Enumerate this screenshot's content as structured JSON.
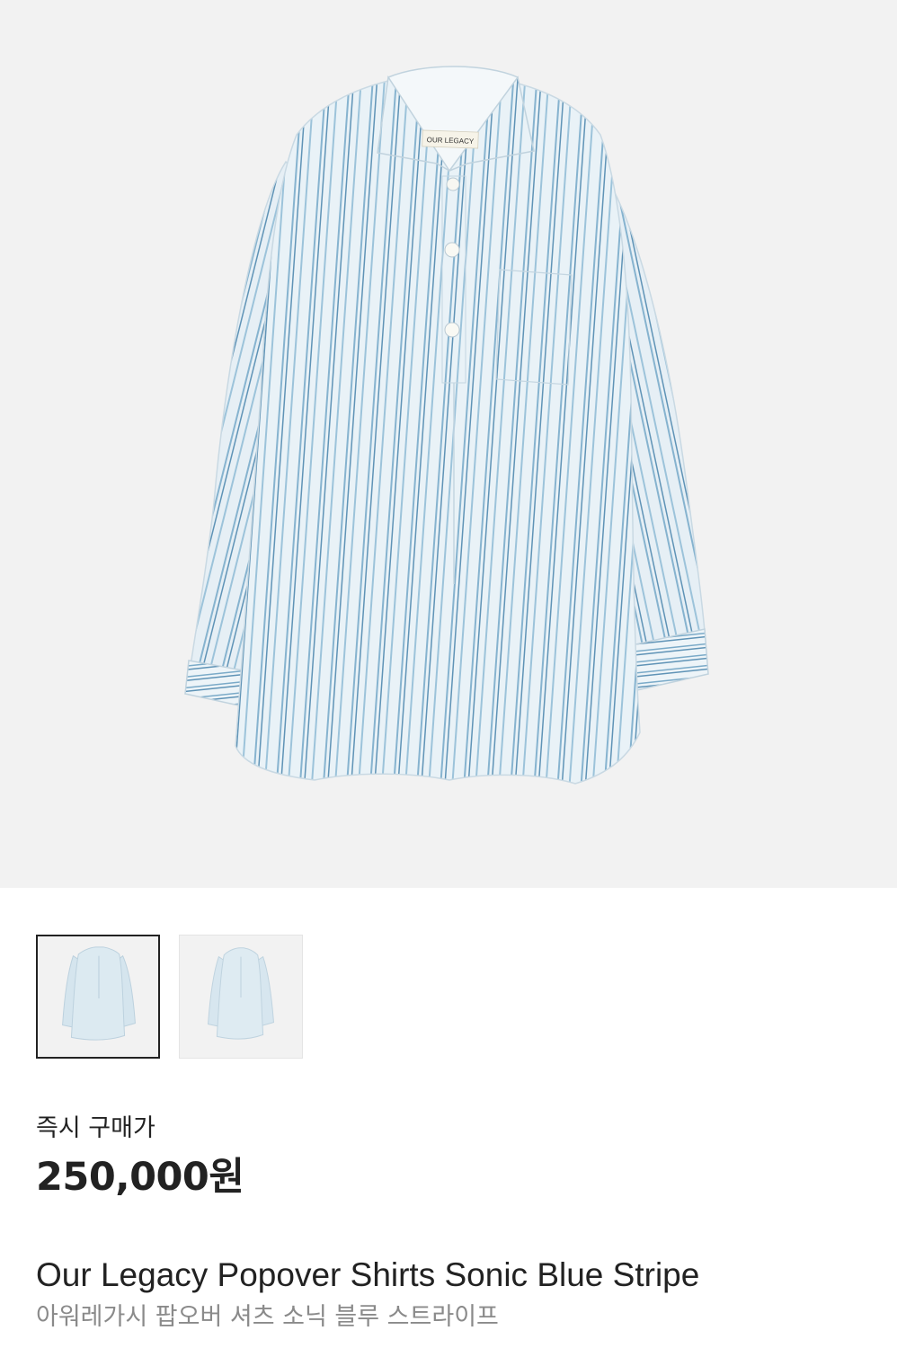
{
  "product": {
    "image": {
      "label_text": "OUR LEGACY",
      "background": "#f2f2f2",
      "shirt_color": "#e7f1f6",
      "stripe_color": "#6f9fc0"
    },
    "thumbnails": [
      {
        "selected": true
      },
      {
        "selected": false
      }
    ],
    "price_label": "즉시 구매가",
    "price": "250,000원",
    "name_en": "Our Legacy Popover Shirts Sonic Blue Stripe",
    "name_ko": "아워레가시 팝오버 셔츠 소닉 블루 스트라이프"
  }
}
